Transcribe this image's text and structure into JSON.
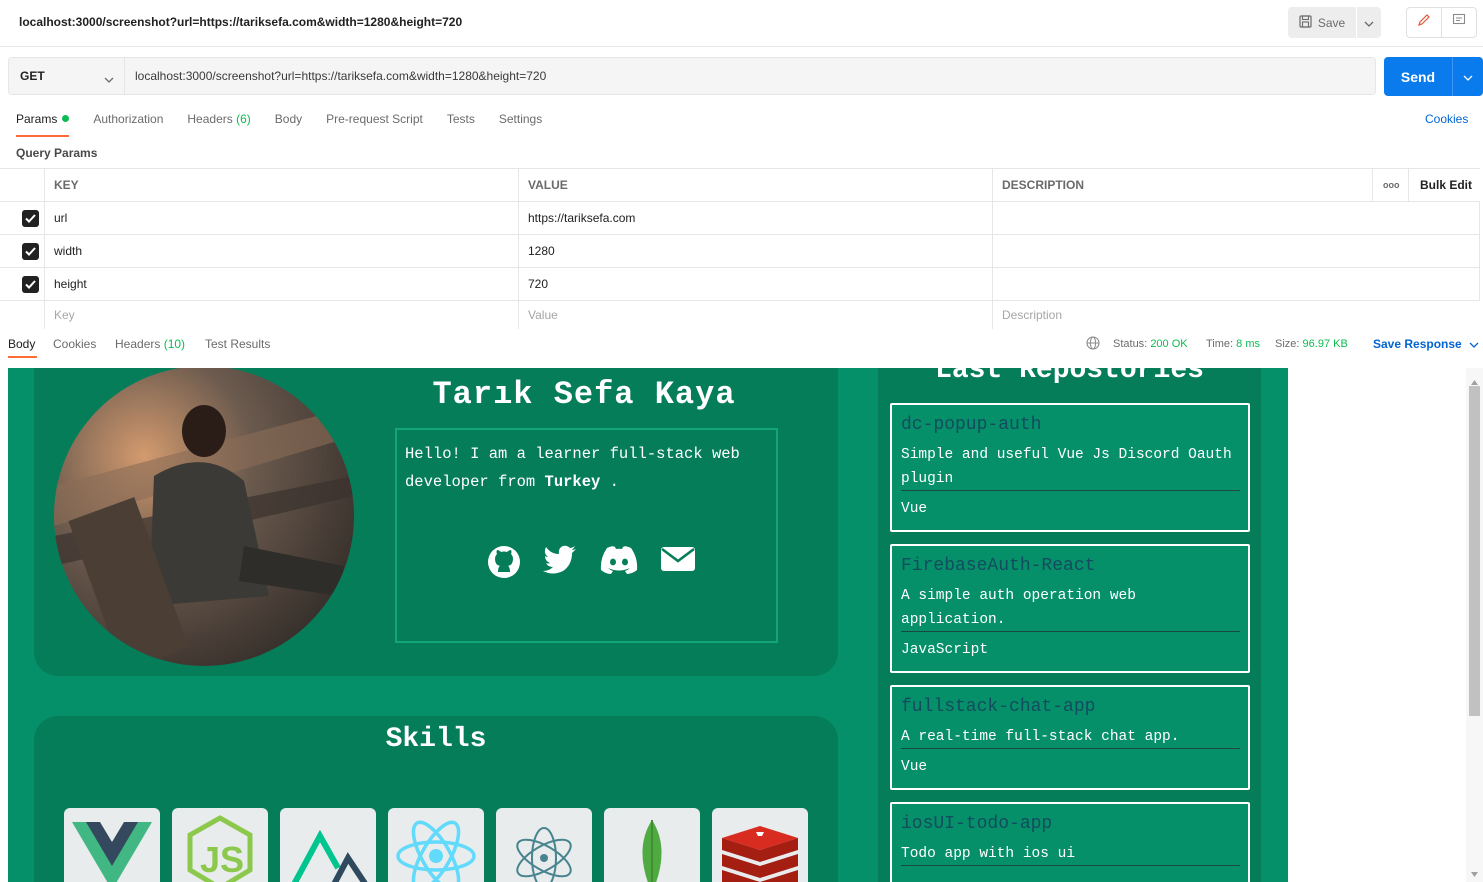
{
  "window": {
    "title": "localhost:3000/screenshot?url=https://tariksefa.com&width=1280&height=720",
    "save_label": "Save"
  },
  "request": {
    "method": "GET",
    "url": "localhost:3000/screenshot?url=https://tariksefa.com&width=1280&height=720",
    "send_label": "Send"
  },
  "tabs": [
    {
      "label": "Params"
    },
    {
      "label": "Authorization"
    },
    {
      "label": "Headers",
      "count": "(6)"
    },
    {
      "label": "Body"
    },
    {
      "label": "Pre-request Script"
    },
    {
      "label": "Tests"
    },
    {
      "label": "Settings"
    }
  ],
  "cookies_link": "Cookies",
  "query_params": {
    "title": "Query Params",
    "headers": {
      "key": "KEY",
      "value": "VALUE",
      "description": "DESCRIPTION",
      "bulk": "Bulk Edit",
      "more": "ooo"
    },
    "rows": [
      {
        "key": "url",
        "value": "https://tariksefa.com"
      },
      {
        "key": "width",
        "value": "1280"
      },
      {
        "key": "height",
        "value": "720"
      }
    ],
    "placeholders": {
      "key": "Key",
      "value": "Value",
      "description": "Description"
    }
  },
  "response": {
    "tabs": [
      "Body",
      "Cookies",
      "Headers",
      "Test Results"
    ],
    "headers_count": "(10)",
    "status_label": "Status:",
    "status": "200 OK",
    "time_label": "Time:",
    "time": "8 ms",
    "size_label": "Size:",
    "size": "96.97 KB",
    "save_response": "Save Response"
  },
  "preview": {
    "name": "Tarık Sefa Kaya",
    "bio_pre": "Hello! I am a learner full-stack web developer from ",
    "bio_bold": "Turkey",
    "bio_post": " .",
    "skills_title": "Skills",
    "repos_title": "Last Repostories",
    "repos": [
      {
        "name": "dc-popup-auth",
        "desc": "Simple and useful Vue Js Discord Oauth plugin",
        "lang": "Vue"
      },
      {
        "name": "FirebaseAuth-React",
        "desc": "A simple auth operation web application.",
        "lang": "JavaScript"
      },
      {
        "name": "fullstack-chat-app",
        "desc": "A real-time full-stack chat app.",
        "lang": "Vue"
      },
      {
        "name": "iosUI-todo-app",
        "desc": "Todo app with ios ui",
        "lang": ""
      }
    ],
    "skill_icons": [
      "vue-icon",
      "nodejs-icon",
      "nuxt-icon",
      "react-icon",
      "electron-icon",
      "mongodb-icon",
      "redis-icon"
    ]
  },
  "colors": {
    "accent": "#ff6c37",
    "send": "#097bed",
    "link": "#0265d2",
    "ok": "#0cbb52",
    "site_bg": "#069069",
    "site_card": "#057d59"
  }
}
